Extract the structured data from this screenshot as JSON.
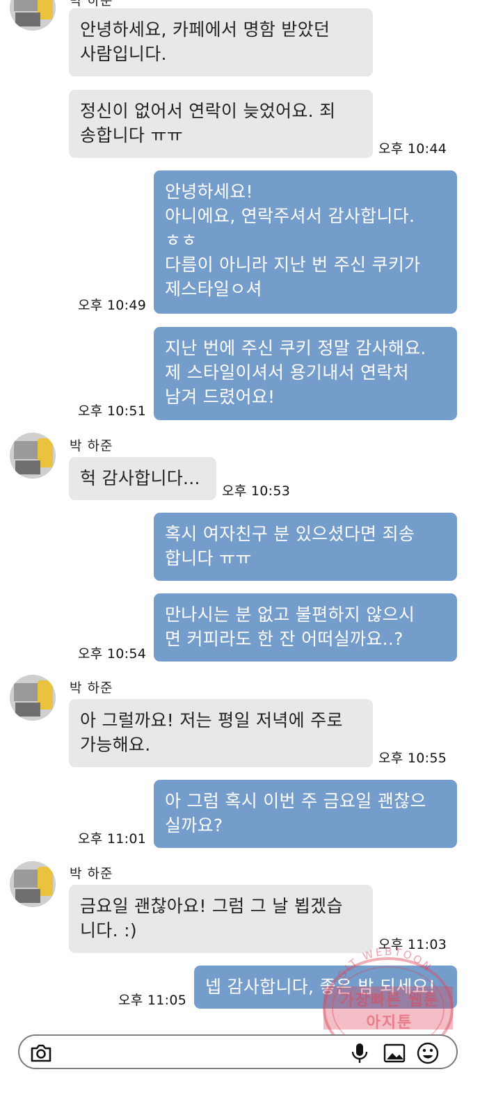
{
  "contact": {
    "name": "박 하준",
    "avatar_icon": "profile-photo"
  },
  "messages": [
    {
      "dir": "in",
      "text": "안녕하세요, 카페에서 명함 받았던\n사람입니다.",
      "time": ""
    },
    {
      "dir": "in",
      "text": "정신이 없어서 연락이 늦었어요. 죄\n송합니다 ㅠㅠ",
      "time": "오후 10:44"
    },
    {
      "dir": "out",
      "text": "안녕하세요!\n아니에요, 연락주셔서 감사합니다.\nㅎㅎ\n다름이 아니라 지난 번 주신 쿠키가\n제스타일ㅇ셔",
      "time": "오후 10:49"
    },
    {
      "dir": "out",
      "text": "지난 번에 주신 쿠키 정말 감사해요.\n제 스타일이셔서 용기내서 연락처\n남겨 드렸어요!",
      "time": "오후 10:51"
    },
    {
      "dir": "in",
      "text": "헉 감사합니다...",
      "time": "오후 10:53"
    },
    {
      "dir": "out",
      "text": "혹시 여자친구 분 있으셨다면 죄송\n합니다 ㅠㅠ",
      "time": ""
    },
    {
      "dir": "out",
      "text": "만나시는 분 없고 불편하지 않으시\n면 커피라도 한 잔 어떠실까요..?",
      "time": "오후 10:54"
    },
    {
      "dir": "in",
      "text": "아 그럴까요! 저는 평일 저녁에 주로\n가능해요.",
      "time": "오후 10:55"
    },
    {
      "dir": "out",
      "text": "아 그럼 혹시 이번 주 금요일 괜찮으\n실까요?",
      "time": "오후 11:01"
    },
    {
      "dir": "in",
      "text": "금요일 괜찮아요! 그럼 그 날 뵙겠습\n니다. :)",
      "time": "오후 11:03"
    },
    {
      "dir": "out",
      "text": "넵 감사합니다, 좋은 밤 되세요!",
      "time": "오후 11:05"
    }
  ],
  "input_bar": {
    "placeholder": "",
    "icons": [
      "camera-icon",
      "microphone-icon",
      "gallery-icon",
      "emoji-icon"
    ]
  },
  "watermark": {
    "line1": "가장빠른 웹툰",
    "line2": "아지툰",
    "ring": "GIT WEBTOON"
  },
  "colors": {
    "incoming": "#e8e8e8",
    "outgoing": "#759dcb",
    "watermark": "#de465a"
  }
}
